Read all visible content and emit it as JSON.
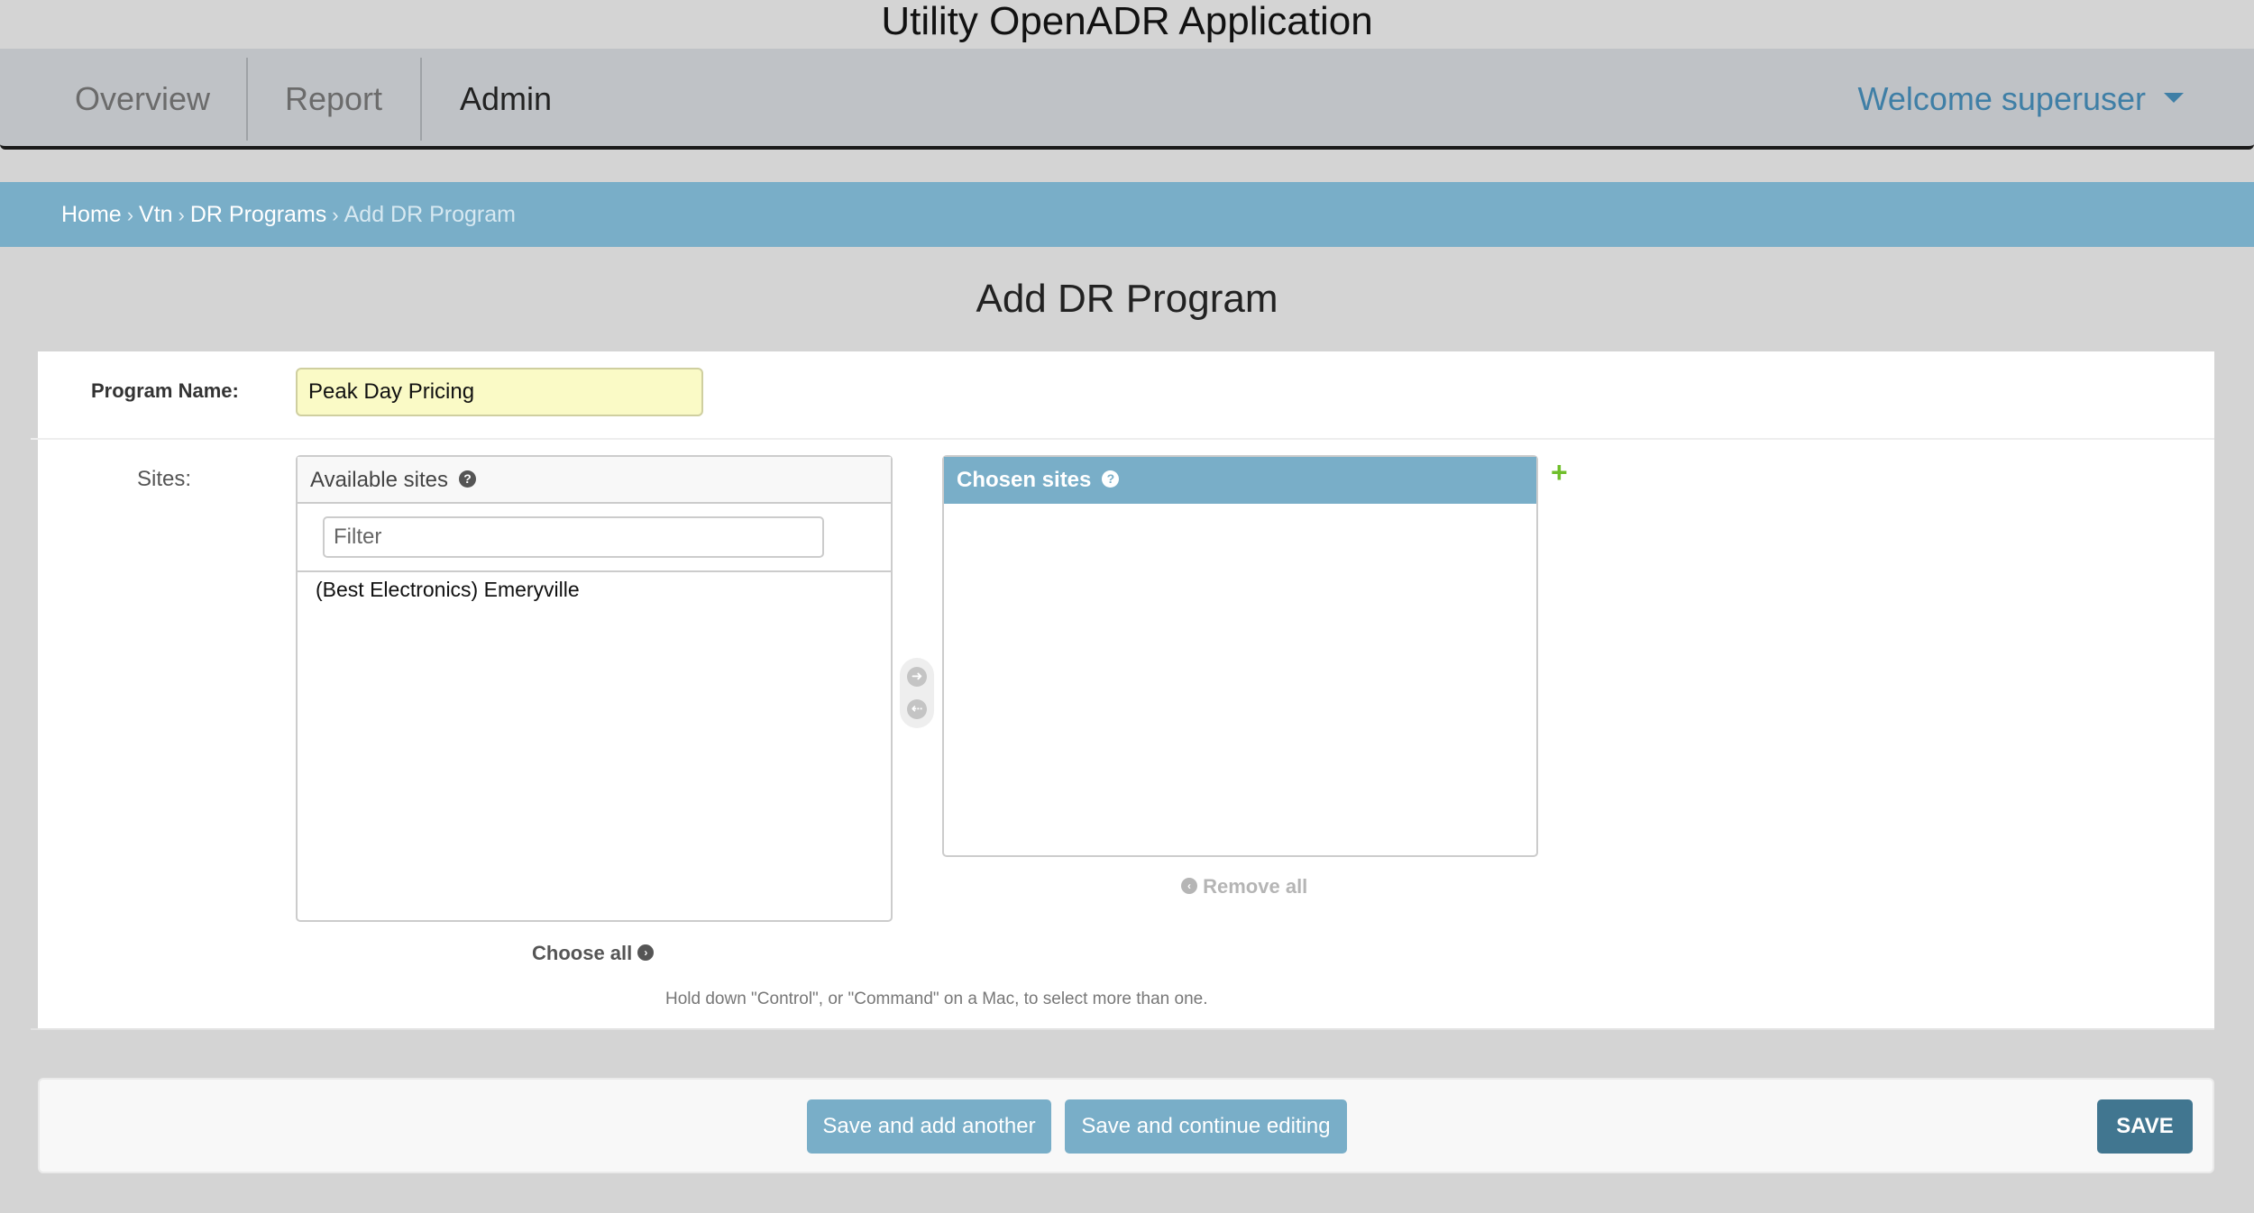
{
  "app": {
    "title": "Utility OpenADR Application"
  },
  "nav": {
    "tabs": [
      {
        "label": "Overview"
      },
      {
        "label": "Report"
      },
      {
        "label": "Admin"
      }
    ],
    "user_menu_label": "Welcome superuser",
    "user_menu_icon": "caret-down-icon"
  },
  "breadcrumbs": {
    "items": [
      "Home",
      "Vtn",
      "DR Programs"
    ],
    "separator": "›",
    "current": "Add DR Program"
  },
  "page": {
    "title": "Add DR Program"
  },
  "form": {
    "program_name_label": "Program Name:",
    "program_name_value": "Peak Day Pricing",
    "sites_label": "Sites:",
    "available": {
      "title": "Available sites",
      "help_icon": "?",
      "filter_placeholder": "Filter",
      "options": [
        "(Best Electronics) Emeryville"
      ],
      "choose_all_label": "Choose all"
    },
    "chosen": {
      "title": "Chosen sites",
      "help_icon": "?",
      "options": [],
      "remove_all_label": "Remove all"
    },
    "add_another_icon": "+",
    "help_text": "Hold down \"Control\", or \"Command\" on a Mac, to select more than one."
  },
  "actions": {
    "save_add_another": "Save and add another",
    "save_continue": "Save and continue editing",
    "save": "SAVE"
  },
  "colors": {
    "breadcrumb_bar": "#79aec8",
    "primary_button": "#417690",
    "secondary_button": "#79aec8",
    "add_icon": "#70bf2b",
    "user_menu": "#3f7fa6"
  }
}
